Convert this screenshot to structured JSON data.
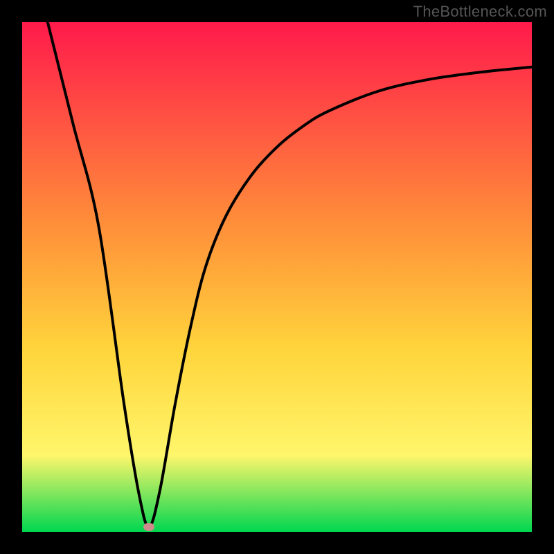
{
  "watermark": "TheBottleneck.com",
  "colors": {
    "frame": "#000000",
    "curve": "#000000",
    "marker": "#cf8b8b",
    "grad_top": "#ff1a4b",
    "grad_mid1": "#ff8a3a",
    "grad_mid2": "#ffd43b",
    "grad_mid3": "#fff66b",
    "grad_bottom": "#00d64f"
  },
  "chart_data": {
    "type": "line",
    "title": "",
    "xlabel": "",
    "ylabel": "",
    "xlim": [
      0,
      100
    ],
    "ylim": [
      0,
      100
    ],
    "annotations": [
      "TheBottleneck.com"
    ],
    "marker": {
      "x": 24.9,
      "y": 1
    },
    "series": [
      {
        "name": "bottleneck-curve",
        "x": [
          5,
          10,
          15,
          20,
          23,
          24.9,
          27,
          30,
          33,
          36,
          40,
          45,
          50,
          55,
          60,
          70,
          80,
          90,
          100
        ],
        "y": [
          100,
          80,
          60,
          25,
          7,
          1,
          8,
          25,
          40,
          52,
          62,
          70,
          75.5,
          79.5,
          82.5,
          86.5,
          88.8,
          90.2,
          91.2
        ]
      }
    ]
  }
}
